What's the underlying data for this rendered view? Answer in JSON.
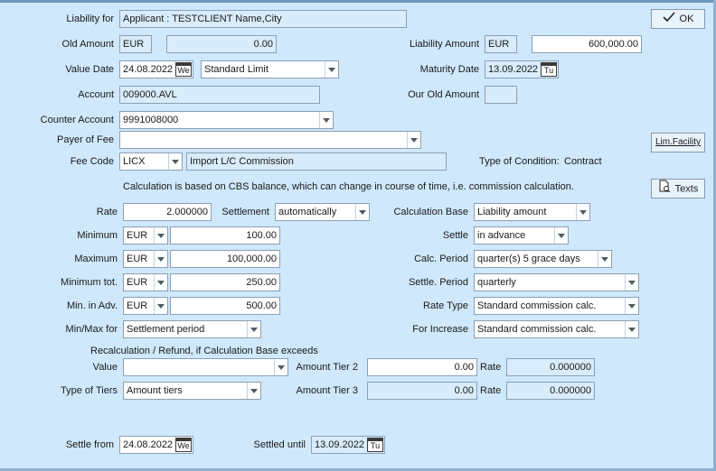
{
  "buttons": {
    "ok": "OK",
    "lim_facility": "Lim.Facility",
    "texts": "Texts"
  },
  "liability_for": {
    "label": "Liability for",
    "value": "Applicant : TESTCLIENT Name,City"
  },
  "old_amount": {
    "label": "Old Amount",
    "currency": "EUR",
    "value": "0.00"
  },
  "liability_amount": {
    "label": "Liability Amount",
    "currency": "EUR",
    "value": "600,000.00"
  },
  "value_date": {
    "label": "Value Date",
    "value": "24.08.2022",
    "day": "We",
    "limit": "Standard Limit"
  },
  "maturity_date": {
    "label": "Maturity Date",
    "value": "13.09.2022",
    "day": "Tu"
  },
  "account": {
    "label": "Account",
    "value": "009000.AVL"
  },
  "our_old_amount": {
    "label": "Our Old Amount",
    "value": ""
  },
  "counter_account": {
    "label": "Counter Account",
    "value": "9991008000"
  },
  "payer_of_fee": {
    "label": "Payer of Fee",
    "value": ""
  },
  "fee_code": {
    "label": "Fee Code",
    "code": "LICX",
    "description": "Import L/C Commission"
  },
  "type_of_condition": {
    "label": "Type of Condition:",
    "value": "Contract"
  },
  "calculation_note": "Calculation is based on CBS balance, which can change in course of time, i.e. commission calculation.",
  "rate": {
    "label": "Rate",
    "value": "2.000000"
  },
  "settlement": {
    "label": "Settlement",
    "value": "automatically"
  },
  "calculation_base": {
    "label": "Calculation Base",
    "value": "Liability amount"
  },
  "minimum": {
    "label": "Minimum",
    "currency": "EUR",
    "value": "100.00"
  },
  "settle": {
    "label": "Settle",
    "value": "in advance"
  },
  "maximum": {
    "label": "Maximum",
    "currency": "EUR",
    "value": "100,000.00"
  },
  "calc_period": {
    "label": "Calc. Period",
    "value": "quarter(s) 5 grace days"
  },
  "minimum_tot": {
    "label": "Minimum tot.",
    "currency": "EUR",
    "value": "250.00"
  },
  "settle_period": {
    "label": "Settle. Period",
    "value": "quarterly"
  },
  "min_in_adv": {
    "label": "Min. in Adv.",
    "currency": "EUR",
    "value": "500.00"
  },
  "rate_type": {
    "label": "Rate Type",
    "value": "Standard commission calc."
  },
  "min_max_for": {
    "label": "Min/Max for",
    "value": "Settlement period"
  },
  "for_increase": {
    "label": "For Increase",
    "value": "Standard commission calc."
  },
  "recalc_note": "Recalculation / Refund, if Calculation Base exceeds",
  "value_select": {
    "label": "Value",
    "value": ""
  },
  "amount_tier_2": {
    "label": "Amount Tier 2",
    "value": "0.00",
    "rate_label": "Rate",
    "rate": "0.000000"
  },
  "type_of_tiers": {
    "label": "Type of Tiers",
    "value": "Amount tiers"
  },
  "amount_tier_3": {
    "label": "Amount Tier 3",
    "value": "0.00",
    "rate_label": "Rate",
    "rate": "0.000000"
  },
  "settle_from": {
    "label": "Settle from",
    "value": "24.08.2022",
    "day": "We"
  },
  "settled_until": {
    "label": "Settled until",
    "value": "13.09.2022",
    "day": "Tu"
  }
}
